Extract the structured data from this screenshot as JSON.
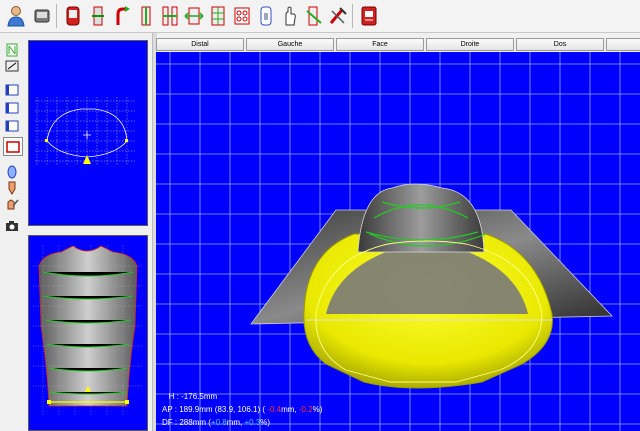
{
  "views": {
    "tabs": [
      "Distal",
      "Gauche",
      "Face",
      "Droite",
      "Dos"
    ]
  },
  "measurements": {
    "h_label": "H :",
    "h_value": "-176.5mm",
    "ap_label": "AP :",
    "ap_value": "189.9mm (83.9, 106.1) (",
    "ap_delta_mm": "-0.4",
    "ap_mid": "mm, ",
    "ap_delta_pct": "-0.2",
    "ap_end": "%)",
    "df_label": "DF :",
    "df_value": "288mm (",
    "df_delta_mm": "+0.8",
    "df_mid": "mm, ",
    "df_delta_pct": "+0.3",
    "df_end": "%)"
  },
  "colors": {
    "viewport_bg": "#0000ff",
    "grid": "#8fa6ff",
    "socket_fill": "#f0f000",
    "contour_green": "#22cc22",
    "contour_red": "#d62020",
    "negative": "#ff3030",
    "positive": "#4fc3ff"
  },
  "icons": {
    "toolbar": [
      "patient-icon",
      "scanner-icon",
      "socket-icon",
      "cut-icon",
      "arrow-socket-icon",
      "column-icon",
      "pillars-icon",
      "resize-icon",
      "grid-shape-icon",
      "rectify-icon",
      "hand-icon",
      "slice-icon",
      "tools-icon",
      "export-icon"
    ],
    "left": [
      "new-section-icon",
      "erase-icon",
      "view-small-1-icon",
      "view-small-2-icon",
      "view-small-3-icon",
      "view-red-icon",
      "cylinder-icon",
      "torso-icon",
      "pencil-hand-icon",
      "camera-icon"
    ]
  }
}
